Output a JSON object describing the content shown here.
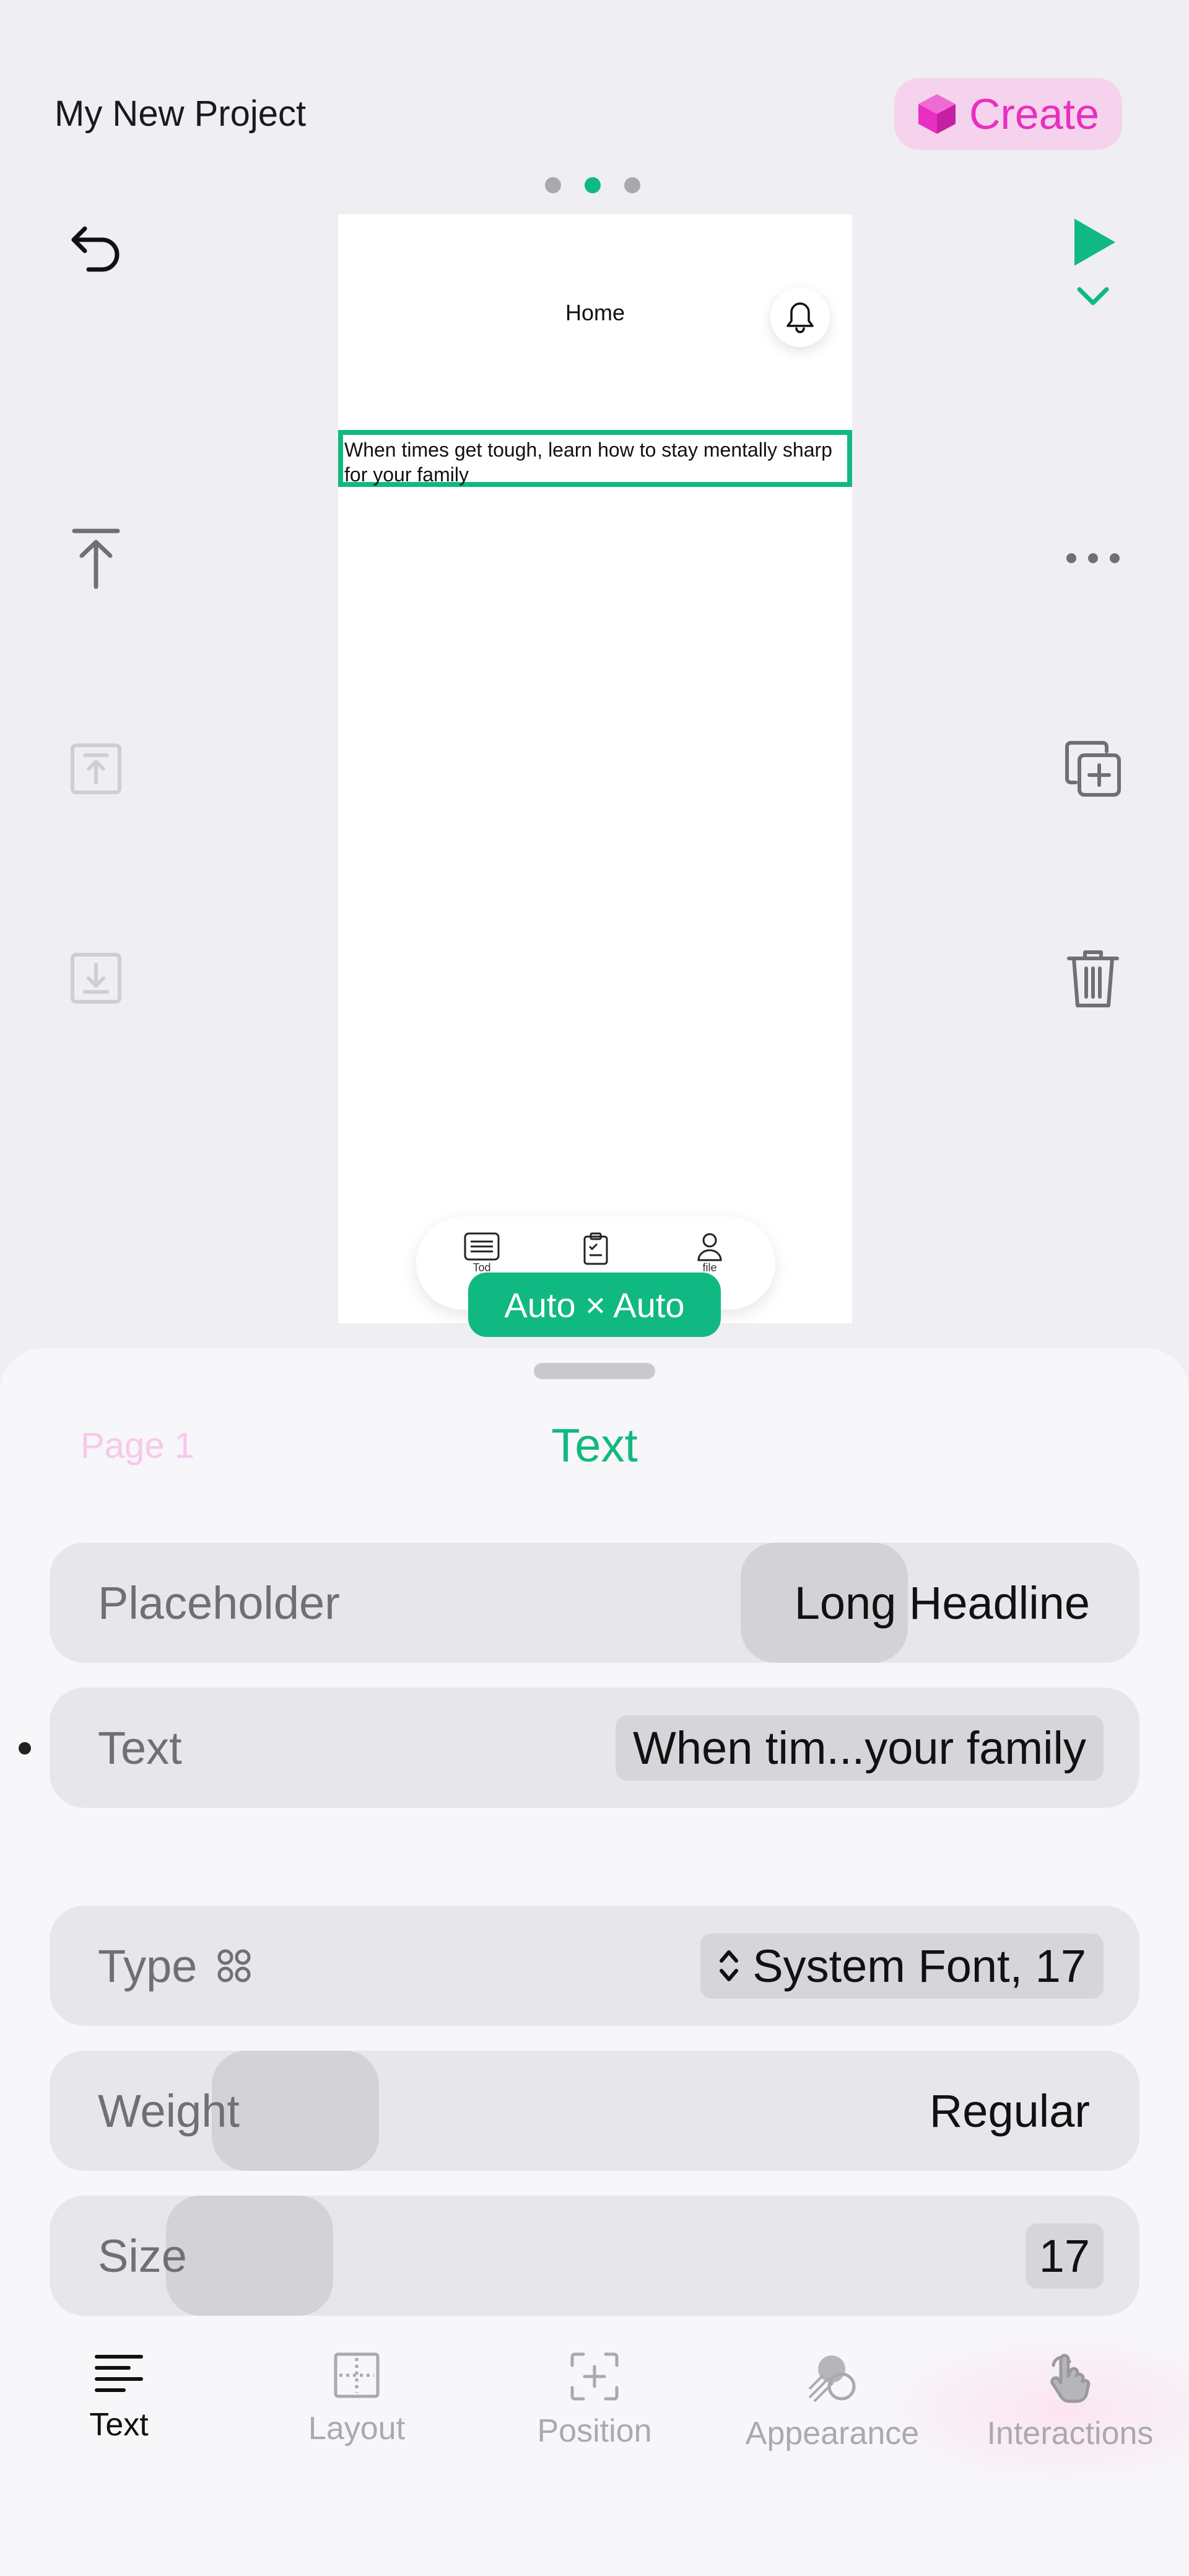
{
  "header": {
    "project_title": "My New Project",
    "create_label": "Create",
    "page_dots": 3,
    "active_dot": 2
  },
  "canvas": {
    "screen_title": "Home",
    "selected_text": "When times get tough, learn how to stay mentally sharp for your family",
    "tabs": [
      {
        "label": "Tod",
        "icon": "list-icon"
      },
      {
        "label": "",
        "icon": "clipboard-icon"
      },
      {
        "label": "file",
        "icon": "profile-icon"
      }
    ],
    "size_label": "Auto × Auto"
  },
  "sheet": {
    "page_link": "Page 1",
    "title": "Text",
    "rows": {
      "placeholder": {
        "label": "Placeholder",
        "value": "Long Headline"
      },
      "text": {
        "label": "Text",
        "value": "When tim...your family"
      },
      "type": {
        "label": "Type",
        "value": "System Font, 17"
      },
      "weight": {
        "label": "Weight",
        "value": "Regular"
      },
      "size": {
        "label": "Size",
        "value": "17"
      }
    }
  },
  "toolbar": {
    "items": [
      {
        "label": "Text",
        "icon": "text-align-icon",
        "active": true
      },
      {
        "label": "Layout",
        "icon": "layout-icon",
        "active": false
      },
      {
        "label": "Position",
        "icon": "position-icon",
        "active": false
      },
      {
        "label": "Appearance",
        "icon": "appearance-icon",
        "active": false
      },
      {
        "label": "Interactions",
        "icon": "hand-tap-icon",
        "active": false
      }
    ]
  },
  "colors": {
    "accent": "#10b981",
    "create": "#e82fc0",
    "create_bg": "#f6d3ec"
  }
}
